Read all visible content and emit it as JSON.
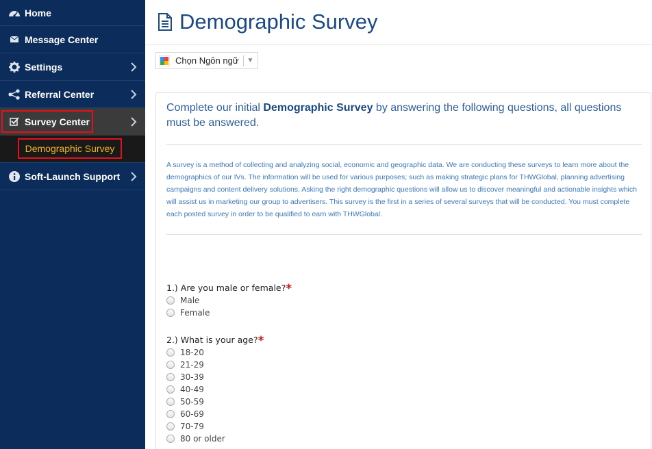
{
  "sidebar": {
    "items": [
      {
        "label": "Home",
        "icon": "dashboard-icon"
      },
      {
        "label": "Message Center",
        "icon": "envelope-icon"
      },
      {
        "label": "Settings",
        "icon": "gear-icon"
      },
      {
        "label": "Referral Center",
        "icon": "share-icon"
      },
      {
        "label": "Survey Center",
        "icon": "checkbox-icon"
      },
      {
        "label": "Soft-Launch Support",
        "icon": "info-icon"
      }
    ],
    "subitem": {
      "label": "Demographic Survey"
    },
    "colors": {
      "background": "#0c2d5c",
      "active": "#3b3b3b",
      "highlight": "#e0121d",
      "subitem_text": "#f1b51c"
    }
  },
  "header": {
    "title": "Demographic Survey"
  },
  "translate": {
    "label": "Chọn Ngôn ngữ"
  },
  "survey": {
    "intro_prefix": "Complete our initial ",
    "intro_bold": "Demographic Survey",
    "intro_suffix": " by answering the following questions, all questions must be answered.",
    "description": "A survey is a method of collecting and analyzing social, economic and geographic data. We are conducting these surveys to learn more about the demographics of our IVs. The information will be used for various purposes; such as making strategic plans for THWGlobal, planning advertising campaigns and content delivery solutions. Asking the right demographic questions will allow us to discover meaningful and actionable insights which will assist us in marketing our group to advertisers. This survey is the first in a series of several surveys that will be conducted. You must complete each posted survey in order to be qualified to earn with THWGlobal.",
    "questions": [
      {
        "label": "1.) Are you male or female?",
        "required": "*",
        "options": [
          "Male",
          "Female"
        ]
      },
      {
        "label": "2.) What is your age?",
        "required": "*",
        "options": [
          "18-20",
          "21-29",
          "30-39",
          "40-49",
          "50-59",
          "60-69",
          "70-79",
          "80 or older"
        ]
      }
    ]
  }
}
